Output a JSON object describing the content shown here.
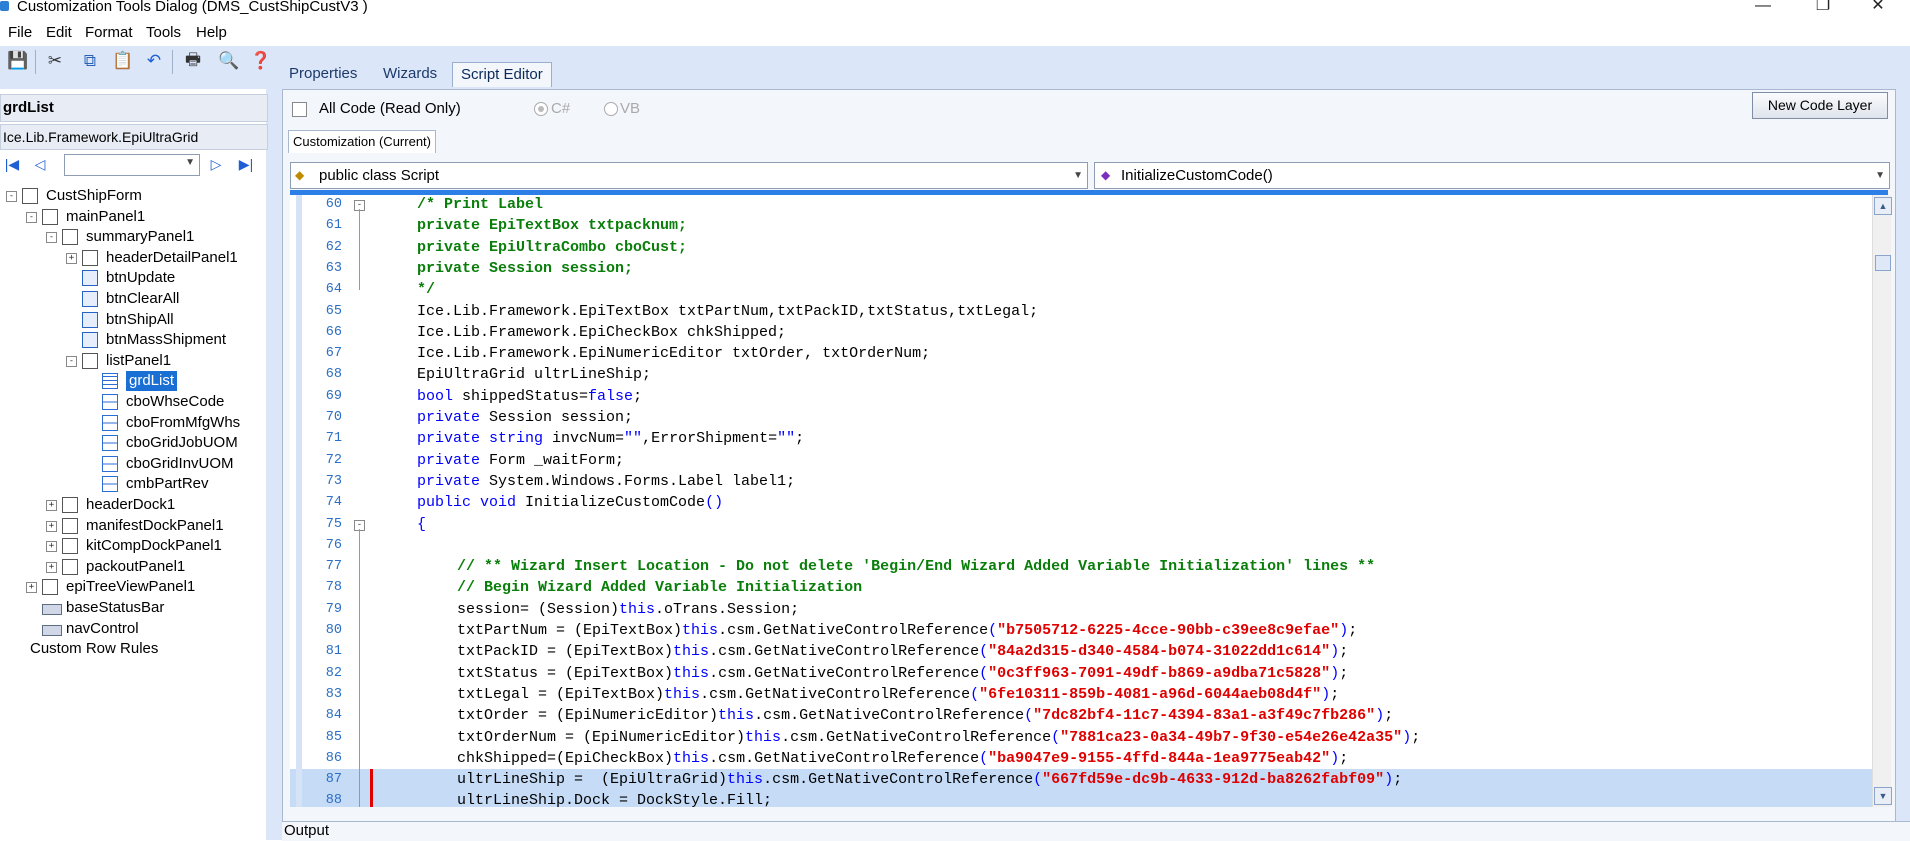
{
  "window": {
    "title": "Customization Tools Dialog  (DMS_CustShipCustV3 )",
    "controls": {
      "minimize": "—",
      "restore": "❐",
      "close": "✕"
    }
  },
  "menu": [
    "File",
    "Edit",
    "Format",
    "Tools",
    "Help"
  ],
  "toolbar_icons": [
    "save-icon",
    "cut-icon",
    "copy-icon",
    "paste-icon",
    "undo-icon",
    "print-icon",
    "print-preview-icon",
    "help-icon"
  ],
  "tabs": [
    "Properties",
    "Wizards",
    "Script Editor"
  ],
  "active_tab": "Script Editor",
  "left": {
    "selected_name": "grdList",
    "selected_type": "Ice.Lib.Framework.EpiUltraGrid",
    "tree": [
      {
        "label": "CustShipForm",
        "level": 0,
        "exp": "-",
        "icon": "form"
      },
      {
        "label": "mainPanel1",
        "level": 1,
        "exp": "-",
        "icon": "panel"
      },
      {
        "label": "summaryPanel1",
        "level": 2,
        "exp": "-",
        "icon": "panel"
      },
      {
        "label": "headerDetailPanel1",
        "level": 3,
        "exp": "+",
        "icon": "panel"
      },
      {
        "label": "btnUpdate",
        "level": 3,
        "exp": "",
        "icon": "btn"
      },
      {
        "label": "btnClearAll",
        "level": 3,
        "exp": "",
        "icon": "btn"
      },
      {
        "label": "btnShipAll",
        "level": 3,
        "exp": "",
        "icon": "btn"
      },
      {
        "label": "btnMassShipment",
        "level": 3,
        "exp": "",
        "icon": "btn"
      },
      {
        "label": "listPanel1",
        "level": 3,
        "exp": "-",
        "icon": "panel"
      },
      {
        "label": "grdList",
        "level": 4,
        "exp": "",
        "icon": "grid",
        "selected": true
      },
      {
        "label": "cboWhseCode",
        "level": 4,
        "exp": "",
        "icon": "combo"
      },
      {
        "label": "cboFromMfgWhs",
        "level": 4,
        "exp": "",
        "icon": "combo"
      },
      {
        "label": "cboGridJobUOM",
        "level": 4,
        "exp": "",
        "icon": "combo"
      },
      {
        "label": "cboGridInvUOM",
        "level": 4,
        "exp": "",
        "icon": "combo"
      },
      {
        "label": "cmbPartRev",
        "level": 4,
        "exp": "",
        "icon": "combo"
      },
      {
        "label": "headerDock1",
        "level": 2,
        "exp": "+",
        "icon": "panel"
      },
      {
        "label": "manifestDockPanel1",
        "level": 2,
        "exp": "+",
        "icon": "panel"
      },
      {
        "label": "kitCompDockPanel1",
        "level": 2,
        "exp": "+",
        "icon": "panel"
      },
      {
        "label": "packoutPanel1",
        "level": 2,
        "exp": "+",
        "icon": "panel"
      },
      {
        "label": "epiTreeViewPanel1",
        "level": 1,
        "exp": "+",
        "icon": "panel"
      },
      {
        "label": "baseStatusBar",
        "level": 1,
        "exp": "",
        "icon": "bar"
      },
      {
        "label": "navControl",
        "level": 1,
        "exp": "",
        "icon": "bar"
      },
      {
        "label": "Custom Row Rules",
        "level": 0.5,
        "exp": "",
        "icon": ""
      }
    ]
  },
  "editor": {
    "all_code_label": "All Code (Read Only)",
    "lang_cs": "C#",
    "lang_vb": "VB",
    "new_code_layer": "New Code Layer",
    "customization_tab": "Customization (Current)",
    "class_dropdown": "public class Script",
    "method_dropdown": "InitializeCustomCode()",
    "output_label": "Output",
    "lines": [
      {
        "n": "60",
        "indent": 0,
        "fold": "-",
        "parts": [
          [
            "c",
            "/* Print Label"
          ]
        ]
      },
      {
        "n": "61",
        "indent": 0,
        "parts": [
          [
            "c",
            "private EpiTextBox txtpacknum;"
          ]
        ]
      },
      {
        "n": "62",
        "indent": 0,
        "parts": [
          [
            "c",
            "private EpiUltraCombo cboCust;"
          ]
        ]
      },
      {
        "n": "63",
        "indent": 0,
        "parts": [
          [
            "c",
            "private Session session;"
          ]
        ]
      },
      {
        "n": "64",
        "indent": 0,
        "foldend": true,
        "parts": [
          [
            "c",
            "*/"
          ]
        ]
      },
      {
        "n": "65",
        "indent": 0,
        "parts": [
          [
            "t",
            "Ice.Lib.Framework.EpiTextBox txtPartNum,txtPackID,txtStatus,txtLegal;"
          ]
        ]
      },
      {
        "n": "66",
        "indent": 0,
        "parts": [
          [
            "t",
            "Ice.Lib.Framework.EpiCheckBox chkShipped;"
          ]
        ]
      },
      {
        "n": "67",
        "indent": 0,
        "parts": [
          [
            "t",
            "Ice.Lib.Framework.EpiNumericEditor txtOrder, txtOrderNum;"
          ]
        ]
      },
      {
        "n": "68",
        "indent": 0,
        "parts": [
          [
            "t",
            "EpiUltraGrid ultrLineShip;"
          ]
        ]
      },
      {
        "n": "69",
        "indent": 0,
        "parts": [
          [
            "k",
            "bool"
          ],
          [
            "t",
            " shippedStatus="
          ],
          [
            "k",
            "false"
          ],
          [
            "t",
            ";"
          ]
        ]
      },
      {
        "n": "70",
        "indent": 0,
        "parts": [
          [
            "k",
            "private"
          ],
          [
            "t",
            " Session session;"
          ]
        ]
      },
      {
        "n": "71",
        "indent": 0,
        "parts": [
          [
            "k",
            "private string"
          ],
          [
            "t",
            " invcNum="
          ],
          [
            "k",
            "\"\""
          ],
          [
            "t",
            ",ErrorShipment="
          ],
          [
            "k",
            "\"\""
          ],
          [
            "t",
            ";"
          ]
        ]
      },
      {
        "n": "72",
        "indent": 0,
        "parts": [
          [
            "k",
            "private"
          ],
          [
            "t",
            " Form _waitForm;"
          ]
        ]
      },
      {
        "n": "73",
        "indent": 0,
        "parts": [
          [
            "k",
            "private"
          ],
          [
            "t",
            " System.Windows.Forms.Label label1;"
          ]
        ]
      },
      {
        "n": "74",
        "indent": 0,
        "parts": [
          [
            "k",
            "public void"
          ],
          [
            "t",
            " InitializeCustomCode"
          ],
          [
            "k",
            "()"
          ]
        ]
      },
      {
        "n": "75",
        "indent": 0,
        "fold": "-",
        "parts": [
          [
            "k",
            "{"
          ]
        ]
      },
      {
        "n": "76",
        "indent": 0,
        "parts": []
      },
      {
        "n": "77",
        "indent": 1,
        "parts": [
          [
            "c",
            "// ** Wizard Insert Location - Do not delete 'Begin/End Wizard Added Variable Initialization' lines **"
          ]
        ]
      },
      {
        "n": "78",
        "indent": 1,
        "parts": [
          [
            "c",
            "// Begin Wizard Added Variable Initialization"
          ]
        ]
      },
      {
        "n": "79",
        "indent": 1,
        "parts": [
          [
            "t",
            "session= (Session)"
          ],
          [
            "k",
            "this"
          ],
          [
            "t",
            ".oTrans.Session;"
          ]
        ]
      },
      {
        "n": "80",
        "indent": 1,
        "parts": [
          [
            "t",
            "txtPartNum = (EpiTextBox)"
          ],
          [
            "k",
            "this"
          ],
          [
            "t",
            ".csm.GetNativeControlReference"
          ],
          [
            "k",
            "("
          ],
          [
            "s",
            "\"b7505712-6225-4cce-90bb-c39ee8c9efae\""
          ],
          [
            "k",
            ")"
          ],
          [
            "t",
            ";"
          ]
        ]
      },
      {
        "n": "81",
        "indent": 1,
        "parts": [
          [
            "t",
            "txtPackID = (EpiTextBox)"
          ],
          [
            "k",
            "this"
          ],
          [
            "t",
            ".csm.GetNativeControlReference"
          ],
          [
            "k",
            "("
          ],
          [
            "s",
            "\"84a2d315-d340-4584-b074-31022dd1c614\""
          ],
          [
            "k",
            ")"
          ],
          [
            "t",
            ";"
          ]
        ]
      },
      {
        "n": "82",
        "indent": 1,
        "parts": [
          [
            "t",
            "txtStatus = (EpiTextBox)"
          ],
          [
            "k",
            "this"
          ],
          [
            "t",
            ".csm.GetNativeControlReference"
          ],
          [
            "k",
            "("
          ],
          [
            "s",
            "\"0c3ff963-7091-49df-b869-a9dba71c5828\""
          ],
          [
            "k",
            ")"
          ],
          [
            "t",
            ";"
          ]
        ]
      },
      {
        "n": "83",
        "indent": 1,
        "parts": [
          [
            "t",
            "txtLegal = (EpiTextBox)"
          ],
          [
            "k",
            "this"
          ],
          [
            "t",
            ".csm.GetNativeControlReference"
          ],
          [
            "k",
            "("
          ],
          [
            "s",
            "\"6fe10311-859b-4081-a96d-6044aeb08d4f\""
          ],
          [
            "k",
            ")"
          ],
          [
            "t",
            ";"
          ]
        ]
      },
      {
        "n": "84",
        "indent": 1,
        "parts": [
          [
            "t",
            "txtOrder = (EpiNumericEditor)"
          ],
          [
            "k",
            "this"
          ],
          [
            "t",
            ".csm.GetNativeControlReference"
          ],
          [
            "k",
            "("
          ],
          [
            "s",
            "\"7dc82bf4-11c7-4394-83a1-a3f49c7fb286\""
          ],
          [
            "k",
            ")"
          ],
          [
            "t",
            ";"
          ]
        ]
      },
      {
        "n": "85",
        "indent": 1,
        "parts": [
          [
            "t",
            "txtOrderNum = (EpiNumericEditor)"
          ],
          [
            "k",
            "this"
          ],
          [
            "t",
            ".csm.GetNativeControlReference"
          ],
          [
            "k",
            "("
          ],
          [
            "s",
            "\"7881ca23-0a34-49b7-9f30-e54e26e42a35\""
          ],
          [
            "k",
            ")"
          ],
          [
            "t",
            ";"
          ]
        ]
      },
      {
        "n": "86",
        "indent": 1,
        "parts": [
          [
            "t",
            "chkShipped=(EpiCheckBox)"
          ],
          [
            "k",
            "this"
          ],
          [
            "t",
            ".csm.GetNativeControlReference"
          ],
          [
            "k",
            "("
          ],
          [
            "s",
            "\"ba9047e9-9155-4ffd-844a-1ea9775eab42\""
          ],
          [
            "k",
            ")"
          ],
          [
            "t",
            ";"
          ]
        ]
      },
      {
        "n": "87",
        "indent": 1,
        "hl": true,
        "parts": [
          [
            "t",
            "ultrLineShip =  (EpiUltraGrid)"
          ],
          [
            "k",
            "this"
          ],
          [
            "t",
            ".csm.GetNativeControlReference"
          ],
          [
            "k",
            "("
          ],
          [
            "s",
            "\"667fd59e-dc9b-4633-912d-ba8262fabf09\""
          ],
          [
            "k",
            ")"
          ],
          [
            "t",
            ";"
          ]
        ]
      },
      {
        "n": "88",
        "indent": 1,
        "hl": true,
        "parts": [
          [
            "t",
            "ultrLineShip.Dock = DockStyle.Fill;"
          ]
        ]
      }
    ]
  }
}
